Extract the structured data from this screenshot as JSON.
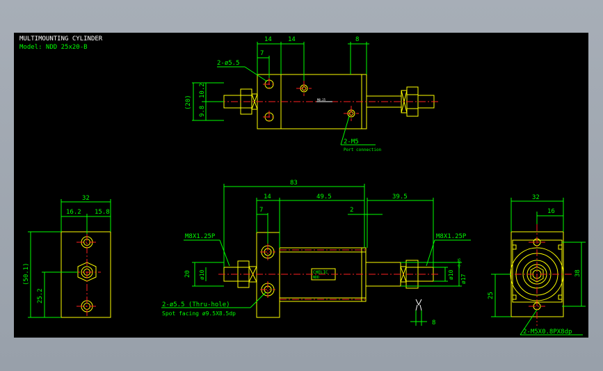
{
  "title": {
    "line1": "MULTIMOUNTING CYLINDER",
    "line2": "Model: NDD 25x20-B"
  },
  "top_view": {
    "dims": {
      "d14a": "14",
      "d14b": "14",
      "d8": "8",
      "d7": "7",
      "d20": "(20)",
      "d10_2": "10.2",
      "d9_8": "9.8"
    },
    "labels": {
      "holes": "2-ø5.5",
      "ports": "2-M5",
      "port_note": "Port connection",
      "tiny": "M8.25"
    }
  },
  "side_view": {
    "dims": {
      "d32": "32",
      "d16_2": "16.2",
      "d15_8": "15.8",
      "d50_1": "(50.1)",
      "d25_2": "25.2"
    }
  },
  "front_view": {
    "dims": {
      "d83": "83",
      "d14": "14",
      "d49_5": "49.5",
      "d39_5": "39.5",
      "d7": "7",
      "d2": "2",
      "d20": "20",
      "d10_left": "ø10",
      "d10_right": "ø10",
      "d17": "ø17",
      "d17_tol": "-0.05",
      "d8": "8"
    },
    "labels": {
      "thread_left": "M8X1.25P",
      "thread_right": "M8X1.25P",
      "holes": "2-ø5.5 (Thru-hole)",
      "spot": "Spot facing   ø9.5X8.5dp",
      "logo1": "CHELIC",
      "logo2": "NDD"
    }
  },
  "end_view": {
    "dims": {
      "d32": "32",
      "d16": "16",
      "d38": "38",
      "d25": "25"
    },
    "labels": {
      "taps": "2-M5X0.8PX8dp"
    }
  },
  "colors": {
    "background": "#000000",
    "dimension": "#00ff00",
    "outline": "#ffff00",
    "centerline": "#ff2020",
    "text_title": "#ffffff"
  }
}
